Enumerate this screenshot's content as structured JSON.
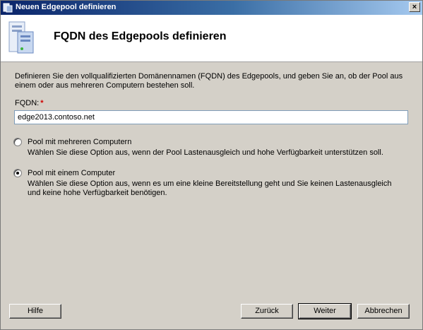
{
  "window": {
    "title": "Neuen Edgepool definieren",
    "close_label": "×"
  },
  "header": {
    "title": "FQDN des Edgepools definieren",
    "icon": "server-icon"
  },
  "description": "Definieren Sie den vollqualifizierten Domänennamen (FQDN) des Edgepools, und geben Sie an, ob der Pool aus einem oder aus mehreren Computern bestehen soll.",
  "fqdn": {
    "label": "FQDN:",
    "required_mark": "*",
    "value": "edge2013.contoso.net"
  },
  "options": [
    {
      "label": "Pool mit mehreren Computern",
      "description": "Wählen Sie diese Option aus, wenn der Pool Lastenausgleich und hohe Verfügbarkeit unterstützen soll.",
      "selected": false
    },
    {
      "label": "Pool mit einem Computer",
      "description": "Wählen Sie diese Option aus, wenn es um eine kleine Bereitstellung geht und Sie keinen Lastenausgleich und keine hohe Verfügbarkeit benötigen.",
      "selected": true
    }
  ],
  "buttons": {
    "help": "Hilfe",
    "back": "Zurück",
    "next": "Weiter",
    "cancel": "Abbrechen"
  },
  "colors": {
    "titlebar_start": "#0a246a",
    "dialog_bg": "#d4d0c8",
    "required": "#d00000"
  }
}
